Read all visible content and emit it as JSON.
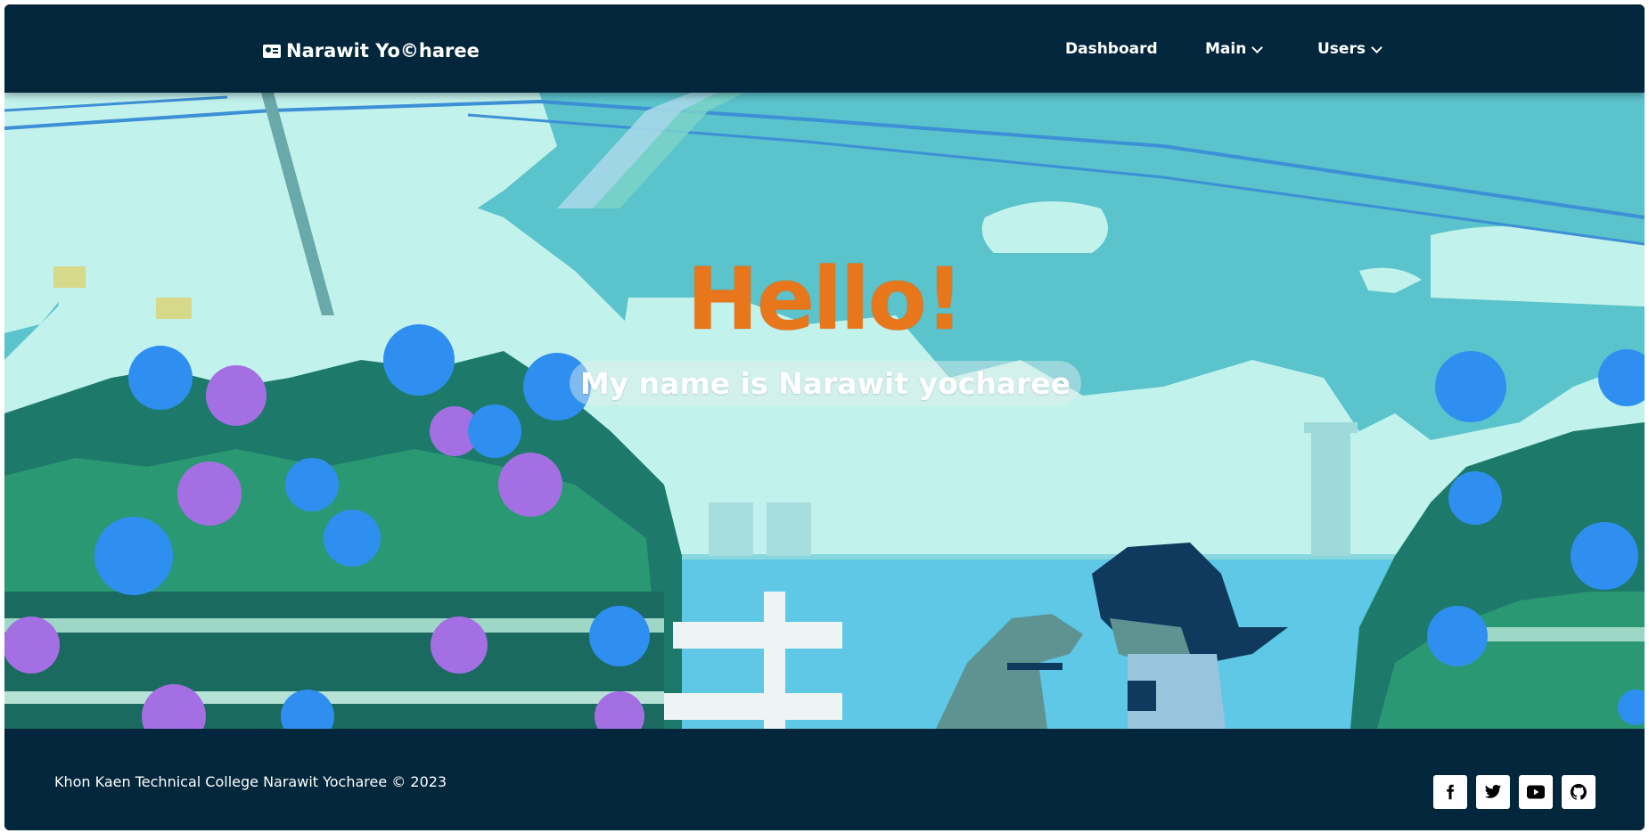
{
  "navbar": {
    "brand": "Narawit Yo©haree",
    "links": [
      {
        "label": "Dashboard"
      },
      {
        "label": "Main"
      },
      {
        "label": "Users"
      }
    ]
  },
  "hero": {
    "title": "Hello!",
    "subtitle": "My name is Narawit yocharee"
  },
  "footer": {
    "copyright": "Khon Kaen Technical College Narawit Yocharee © 2023",
    "social": [
      "facebook-icon",
      "twitter-icon",
      "youtube-icon",
      "github-icon"
    ]
  },
  "colors": {
    "nav_bg": "#02263b",
    "title": "#e8761b",
    "sky": "#5bc3cc"
  }
}
